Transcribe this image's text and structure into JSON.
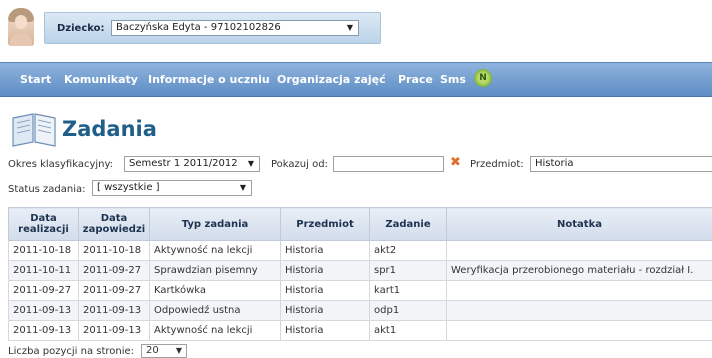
{
  "header": {
    "child_label": "Dziecko:",
    "child_value": "Baczyńska Edyta - 97102102826"
  },
  "nav": {
    "items": [
      "Start",
      "Komunikaty",
      "Informacje o uczniu",
      "Organizacja zajęć",
      "Prace",
      "Sms"
    ],
    "sms_badge": "N"
  },
  "page": {
    "title": "Zadania"
  },
  "filters": {
    "period_label": "Okres klasyfikacyjny:",
    "period_value": "Semestr 1 2011/2012",
    "from_label": "Pokazuj od:",
    "from_value": "",
    "subject_label": "Przedmiot:",
    "subject_value": "Historia",
    "status_label": "Status zadania:",
    "status_value": "[ wszystkie ]"
  },
  "table": {
    "headers": [
      "Data realizacji",
      "Data zapowiedzi",
      "Typ zadania",
      "Przedmiot",
      "Zadanie",
      "Notatka"
    ],
    "rows": [
      [
        "2011-10-18",
        "2011-10-18",
        "Aktywność na lekcji",
        "Historia",
        "akt2",
        ""
      ],
      [
        "2011-10-11",
        "2011-09-27",
        "Sprawdzian pisemny",
        "Historia",
        "spr1",
        "Weryfikacja przerobionego materiału - rozdział I."
      ],
      [
        "2011-09-27",
        "2011-09-27",
        "Kartkówka",
        "Historia",
        "kart1",
        ""
      ],
      [
        "2011-09-13",
        "2011-09-13",
        "Odpowiedź ustna",
        "Historia",
        "odp1",
        ""
      ],
      [
        "2011-09-13",
        "2011-09-13",
        "Aktywność na lekcji",
        "Historia",
        "akt1",
        ""
      ]
    ]
  },
  "pager": {
    "label": "Liczba pozycji na stronie:",
    "value": "20"
  },
  "colors": {
    "nav_bar": "#6f9ad0",
    "title": "#1f5f8a",
    "clear_icon": "#e06d2a",
    "sms_icon": "#8bc34a"
  }
}
